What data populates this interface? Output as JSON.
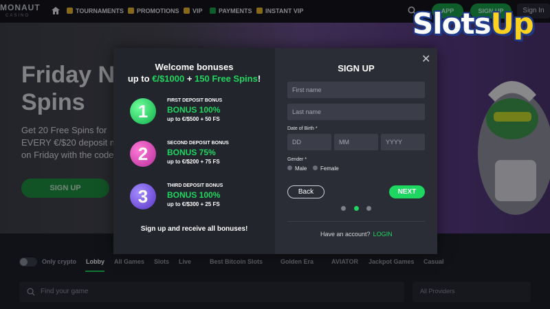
{
  "nav": {
    "logo": "MONAUT",
    "logo_sub": "CASINO",
    "items": [
      "TOURNAMENTS",
      "PROMOTIONS",
      "VIP",
      "PAYMENTS",
      "INSTANT VIP"
    ],
    "app_label": "APP",
    "signup_label": "SIGN UP",
    "signin_label": "Sign In"
  },
  "hero": {
    "title_line1": "Friday N",
    "title_line2": "Spins",
    "sub_line1": "Get 20 Free Spins for",
    "sub_line2": "EVERY €/$20 deposit m",
    "sub_line3": "on Friday with the code",
    "button": "SIGN UP"
  },
  "filters": {
    "only_crypto": "Only crypto",
    "categories": [
      "Lobby",
      "All Games",
      "Slots",
      "Live",
      "Best Bitcoin Slots",
      "Golden Era",
      "AVIATOR",
      "Jackpot Games",
      "Casual"
    ],
    "search_placeholder": "Find your game",
    "providers": "All Providers"
  },
  "modal": {
    "welcome_line1": "Welcome bonuses",
    "welcome_up_to": "up to",
    "welcome_amount": "€/$1000",
    "welcome_plus": "+",
    "welcome_spins": "150 Free Spins",
    "welcome_excl": "!",
    "bonuses": [
      {
        "num": "1",
        "label": "FIRST DEPOSIT BONUS",
        "bonus": "BONUS 100%",
        "detail": "up to €/$500 + 50 FS"
      },
      {
        "num": "2",
        "label": "SECOND DEPOSIT BONUS",
        "bonus": "BONUS 75%",
        "detail": "up to €/$200 + 75 FS"
      },
      {
        "num": "3",
        "label": "THIRD DEPOSIT BONUS",
        "bonus": "BONUS 100%",
        "detail": "up to €/$300 + 25 FS"
      }
    ],
    "footer": "Sign up and receive all bonuses!",
    "close": "✕",
    "signup_title": "SIGN UP",
    "first_name": "First name",
    "last_name": "Last name",
    "dob_label": "Date of Birth",
    "dd": "DD",
    "mm": "MM",
    "yyyy": "YYYY",
    "gender_label": "Gender",
    "male": "Male",
    "female": "Female",
    "back": "Back",
    "next": "NEXT",
    "have_account": "Have an account?",
    "login": "LOGIN",
    "current_step": 2,
    "total_steps": 3
  },
  "brand": {
    "slots": "Slots",
    "up": "Up"
  },
  "colors": {
    "accent": "#1ed760",
    "modal_bg": "#2b2d36",
    "panel_bg": "#23252d"
  }
}
